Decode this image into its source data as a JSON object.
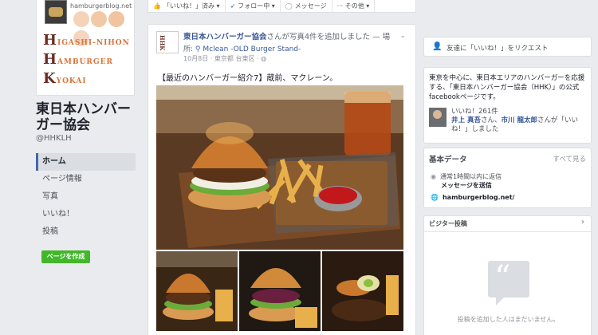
{
  "page": {
    "name": "東日本ハンバーガー協会",
    "handle": "@HHKLH"
  },
  "cover": {
    "site": "hamburgerblog.net",
    "line1_initial": "H",
    "line1_rest": "IGASHI-NIHON",
    "line2_initial": "H",
    "line2_rest": "AMBURGER",
    "line3_initial": "K",
    "line3_rest": "YOKAI",
    "dot_colors": [
      "#f4d3b8",
      "#f2c9a6",
      "#f1c39e",
      "#f4d6bf"
    ]
  },
  "nav": {
    "items": [
      "ホーム",
      "ページ情報",
      "写真",
      "いいね！",
      "投稿"
    ],
    "active_index": 0,
    "create_page": "ページを作成"
  },
  "actionbar": {
    "liked": "「いいね！」済み ▾",
    "following": "フォロー中 ▾",
    "message": "メッセージ",
    "more": "··· その他 ▾"
  },
  "post": {
    "author": "東日本ハンバーガー協会",
    "action": "さんが写真4件を追加しました — 場",
    "location_prefix": "所:",
    "location_name": "Mclean -OLD Burger Stand-",
    "meta": "10月8日 · 東京都 台東区 · ◍",
    "text": "【最近のハンバーガー紹介7】蔵前、マクレーン。"
  },
  "sidebar": {
    "invite": "友達に「いいね！」をリクエスト",
    "about": "東京を中心に、東日本エリアのハンバーガーを応援する、「東日本ハンバーガー協会（HHK）」の公式facebookページです。",
    "likes_count": "いいね！261件",
    "likes_people": "井上 真吾さん、市川 龍太郎さんが「いいね！」しました",
    "likes_name1": "井上 真吾",
    "likes_mid": "さん、",
    "likes_name2": "市川 龍太郎",
    "likes_tail": "さんが「いいね！」しました",
    "basic_title": "基本データ",
    "basic_all": "すべて見る",
    "reply_note": "通常1時間以内に返信",
    "send_message": "メッセージを送信",
    "website": "hamburgerblog.net/",
    "visitor_title": "ビジター投稿",
    "visitor_empty": "投稿を追加した人はまだいません。"
  },
  "colors": {
    "brand_blue": "#4267b2",
    "link_blue": "#385898",
    "create_green": "#42b72a",
    "bg": "#e9ebee"
  }
}
